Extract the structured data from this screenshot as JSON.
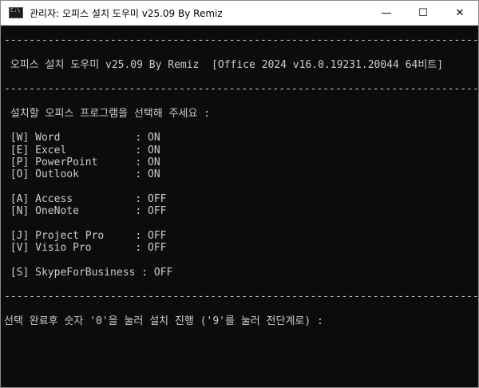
{
  "window": {
    "title": "관리자:  오피스 설치 도우미 v25.09 By Remiz",
    "minimize_glyph": "—",
    "maximize_glyph": "☐",
    "close_glyph": "✕"
  },
  "console": {
    "lines": [
      "------------------------------------------------------------------------------------",
      "",
      " 오피스 설치 도우미 v25.09 By Remiz  [Office 2024 v16.0.19231.20044 64비트]",
      "",
      "------------------------------------------------------------------------------------",
      "",
      " 설치할 오피스 프로그램을 선택해 주세요 :",
      "",
      " [W] Word            : ON",
      " [E] Excel           : ON",
      " [P] PowerPoint      : ON",
      " [O] Outlook         : ON",
      "",
      " [A] Access          : OFF",
      " [N] OneNote         : OFF",
      "",
      " [J] Project Pro     : OFF",
      " [V] Visio Pro       : OFF",
      "",
      " [S] SkypeForBusiness : OFF",
      "",
      "------------------------------------------------------------------------------------",
      "",
      "선택 완료후 숫자 '0'을 눌러 설치 진행 ('9'를 눌러 전단계로) :"
    ]
  }
}
